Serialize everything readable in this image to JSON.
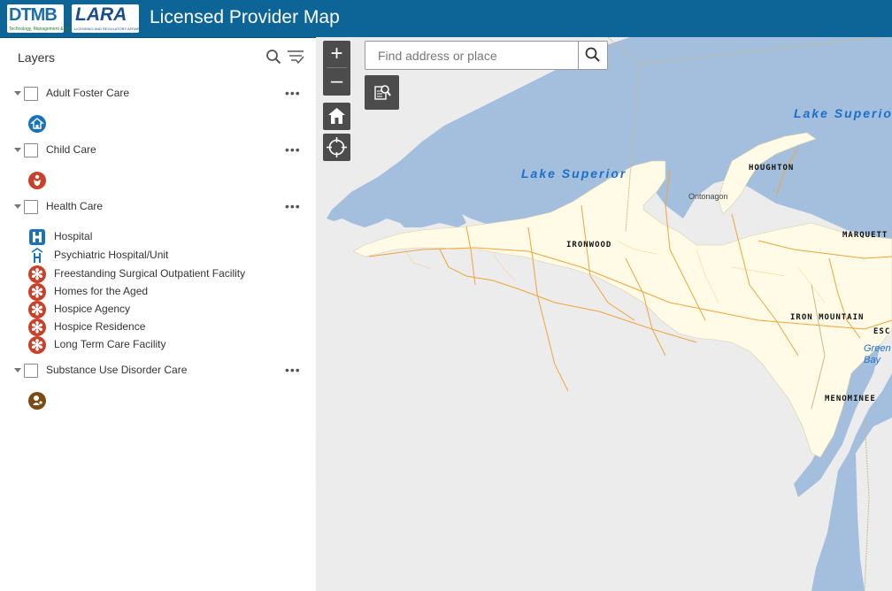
{
  "header": {
    "logo_dtmb": "DTMB",
    "logo_dtmb_sub": "Technology, Management & Budget",
    "logo_lara": "LARA",
    "logo_lara_sub": "LICENSING AND REGULATORY AFFAIRS",
    "title": "Licensed Provider Map"
  },
  "sidebar": {
    "title": "Layers",
    "layers": [
      {
        "label": "Adult Foster Care",
        "legend": []
      },
      {
        "label": "Child Care",
        "legend": []
      },
      {
        "label": "Health Care",
        "legend": [
          {
            "label": "Hospital",
            "icon": "hospital-icon"
          },
          {
            "label": "Psychiatric Hospital/Unit",
            "icon": "psychiatric-hospital-icon"
          },
          {
            "label": "Freestanding Surgical Outpatient Facility",
            "icon": "asterisk-icon"
          },
          {
            "label": "Homes for the Aged",
            "icon": "asterisk-icon"
          },
          {
            "label": "Hospice Agency",
            "icon": "asterisk-icon"
          },
          {
            "label": "Hospice Residence",
            "icon": "asterisk-icon"
          },
          {
            "label": "Long Term Care Facility",
            "icon": "asterisk-icon"
          }
        ]
      },
      {
        "label": "Substance Use Disorder Care",
        "legend": []
      }
    ],
    "more_label": "•••"
  },
  "map": {
    "search_placeholder": "Find address or place",
    "zoom_in": "+",
    "zoom_out": "–",
    "labels": {
      "lake_superior_1": "Lake Superior",
      "lake_superior_2": "Lake Superior",
      "houghton": "HOUGHTON",
      "ontonagon": "Ontonagon",
      "ironwood": "IRONWOOD",
      "marquette": "MARQUETT",
      "iron_mountain": "IRON MOUNTAIN",
      "escanaba": "ESC",
      "green_bay": "Green Bay",
      "menominee": "MENOMINEE"
    },
    "colors": {
      "water": "#a3bfdd",
      "land": "#fffbe6",
      "roads": "#f0a43a",
      "background": "#ececec"
    }
  }
}
